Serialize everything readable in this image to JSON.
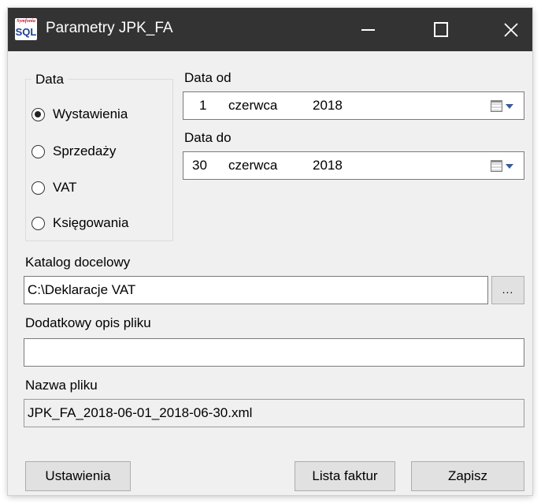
{
  "window": {
    "title": "Parametry JPK_FA",
    "app_icon_text": "SQL",
    "app_icon_brand": "Symfonia"
  },
  "date_group": {
    "legend": "Data",
    "options": [
      {
        "label": "Wystawienia",
        "selected": true
      },
      {
        "label": "Sprzedaży",
        "selected": false
      },
      {
        "label": "VAT",
        "selected": false
      },
      {
        "label": "Księgowania",
        "selected": false
      }
    ]
  },
  "date_from": {
    "label": "Data od",
    "day": "1",
    "month": "czerwca",
    "year": "2018"
  },
  "date_to": {
    "label": "Data do",
    "day": "30",
    "month": "czerwca",
    "year": "2018"
  },
  "target_dir": {
    "label": "Katalog docelowy",
    "value": "C:\\Deklaracje VAT",
    "browse_label": "..."
  },
  "extra_desc": {
    "label": "Dodatkowy opis pliku",
    "value": ""
  },
  "file_name": {
    "label": "Nazwa pliku",
    "value": "JPK_FA_2018-06-01_2018-06-30.xml"
  },
  "buttons": {
    "settings": "Ustawienia",
    "invoice_list": "Lista faktur",
    "save": "Zapisz"
  },
  "colors": {
    "titlebar": "#333333",
    "dialog_bg": "#f0f0f0",
    "button_bg": "#e1e1e1"
  }
}
